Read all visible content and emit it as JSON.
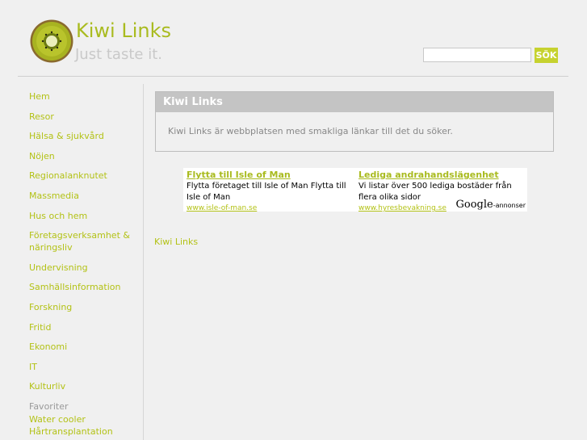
{
  "header": {
    "title": "Kiwi Links",
    "tagline": "Just taste it."
  },
  "search": {
    "value": "",
    "placeholder": "",
    "button_label": "SÖK"
  },
  "nav": {
    "items": [
      "Hem",
      "Resor",
      "Hälsa & sjukvård",
      "Nöjen",
      "Regionalanknutet",
      "Massmedia",
      "Hus och hem",
      "Företagsverksamhet & näringsliv",
      "Undervisning",
      "Samhällsinformation",
      "Forskning",
      "Fritid",
      "Ekonomi",
      "IT",
      "Kulturliv"
    ],
    "favorites_label": "Favoriter",
    "favorites": [
      "Water cooler",
      "Hårtransplantation"
    ]
  },
  "content": {
    "box_title": "Kiwi Links",
    "box_text": "Kiwi Links är webbplatsen med smakliga länkar till det du söker."
  },
  "ads": {
    "items": [
      {
        "title": "Flytta till Isle of Man",
        "desc": "Flytta företaget till Isle of Man Flytta till Isle of Man",
        "url": "www.isle-of-man.se"
      },
      {
        "title": "Lediga andrahandslägenhet",
        "desc": "Vi listar över 500 lediga bostäder från flera olika sidor",
        "url": "www.hyresbevakning.se"
      }
    ],
    "badge_brand": "Google",
    "badge_suffix": "-annonser"
  },
  "footer": {
    "link": "Kiwi Links"
  },
  "colors": {
    "accent": "#b3c216",
    "button": "#c6d22f",
    "box_header": "#c4c4c4"
  }
}
